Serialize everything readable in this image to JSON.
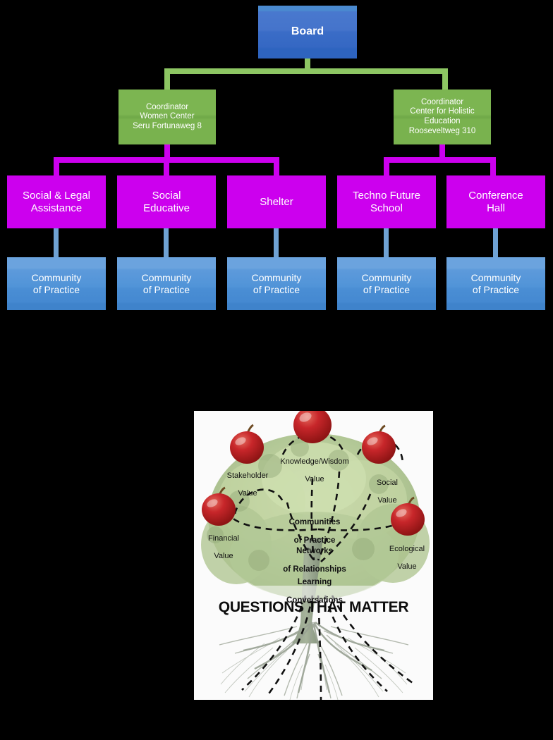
{
  "org_chart": {
    "board": {
      "label": "Board",
      "color": "#3a6cc7"
    },
    "coordinators": [
      {
        "label": "Coordinator\nWomen Center\nSeru Fortunaweg 8",
        "lines": [
          "Coordinator",
          "Women Center",
          "Seru Fortunaweg 8"
        ],
        "color": "#79b24e"
      },
      {
        "label": "Coordinator\nCenter for Holistic Education\nRooseveltweg 310",
        "lines": [
          "Coordinator",
          "Center for Holistic",
          "Education",
          "Rooseveltweg 310"
        ],
        "color": "#79b24e"
      }
    ],
    "units": [
      {
        "lines": [
          "Social & Legal",
          "Assistance"
        ],
        "color": "#cc00ee"
      },
      {
        "lines": [
          "Social",
          "Educative"
        ],
        "color": "#cc00ee"
      },
      {
        "lines": [
          "Shelter"
        ],
        "color": "#cc00ee"
      },
      {
        "lines": [
          "Techno Future",
          "School"
        ],
        "color": "#cc00ee"
      },
      {
        "lines": [
          "Conference",
          "Hall"
        ],
        "color": "#cc00ee"
      }
    ],
    "community_of_practice": [
      {
        "lines": [
          "Community",
          "of Practice"
        ],
        "color": "#4f92d8"
      },
      {
        "lines": [
          "Community",
          "of Practice"
        ],
        "color": "#4f92d8"
      },
      {
        "lines": [
          "Community",
          "of Practice"
        ],
        "color": "#4f92d8"
      },
      {
        "lines": [
          "Community",
          "of Practice"
        ],
        "color": "#4f92d8"
      },
      {
        "lines": [
          "Community",
          "of Practice"
        ],
        "color": "#4f92d8"
      }
    ],
    "connector_colors": {
      "board_to_coordinator": "#8dc663",
      "coordinator_to_unit": "#cc00ee",
      "unit_to_cop": "#6fa2d4"
    }
  },
  "value_tree": {
    "apples": [
      {
        "name": "Stakeholder Value",
        "line1": "Stakeholder",
        "line2": "Value"
      },
      {
        "name": "Knowledge/Wisdom Value",
        "line1": "Knowledge/Wisdom",
        "line2": "Value"
      },
      {
        "name": "Social Value",
        "line1": "Social",
        "line2": "Value"
      },
      {
        "name": "Financial Value",
        "line1": "Financial",
        "line2": "Value"
      },
      {
        "name": "Ecological Value",
        "line1": "Ecological",
        "line2": "Value"
      }
    ],
    "center_labels": [
      {
        "line1": "Communities",
        "line2": "of Practice"
      },
      {
        "line1": "Networks",
        "line2": "of Relationships"
      },
      {
        "line1": "Learning",
        "line2": "Conversations"
      }
    ],
    "root_caption": "QUESTIONS THAT MATTER",
    "colors": {
      "apple": "#c42b2b",
      "foliage": "#9fbf7e",
      "root": "#9aa394",
      "background": "#fbfbfb"
    }
  }
}
